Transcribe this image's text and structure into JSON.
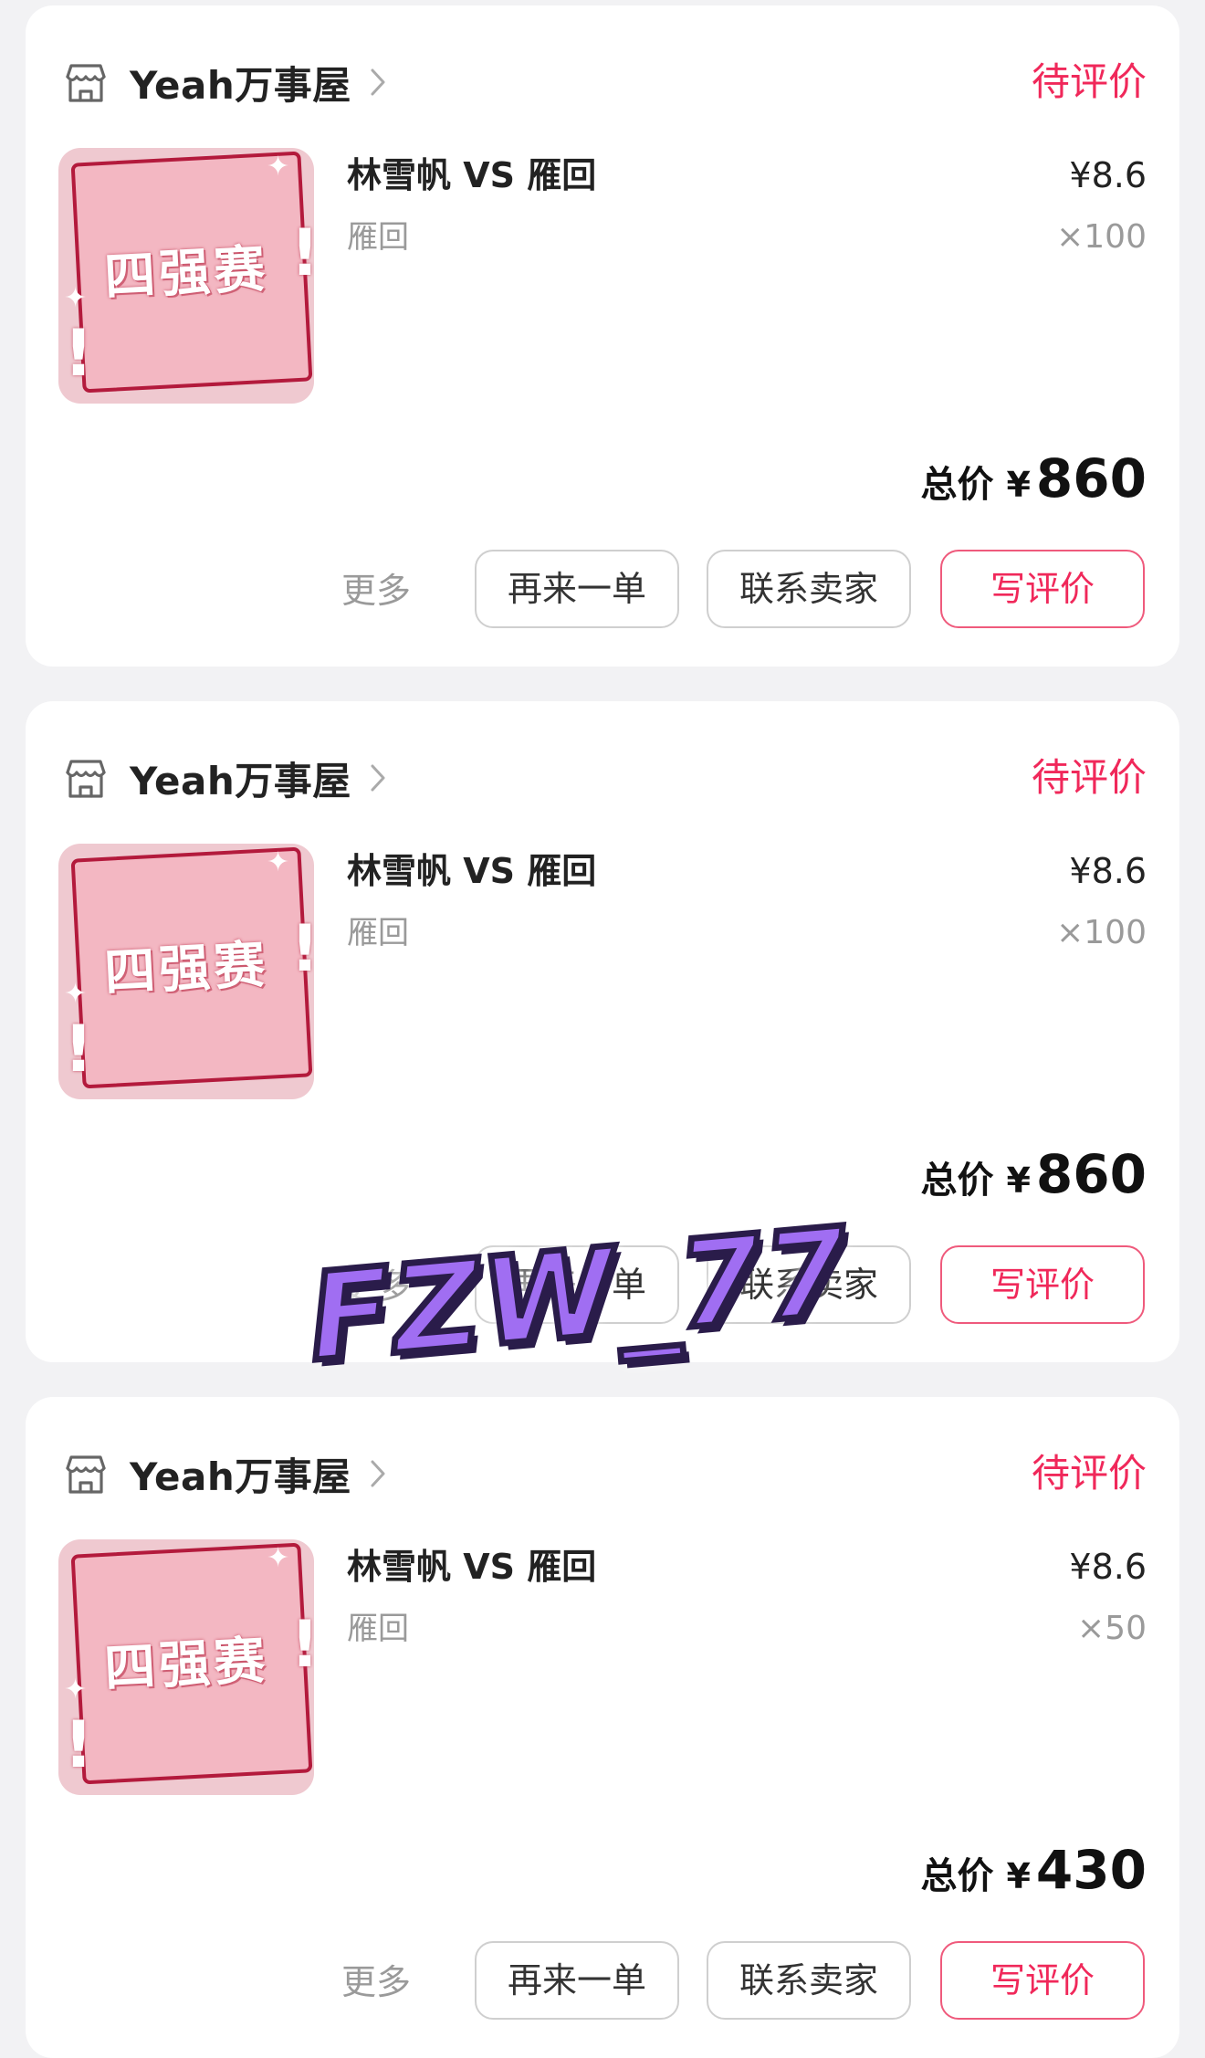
{
  "orders": [
    {
      "shop_name": "Yeah万事屋",
      "status": "待评价",
      "thumb_text": "四强赛",
      "item_title": "林雪帆 VS 雁回",
      "item_subtitle": "雁回",
      "unit_price": "¥8.6",
      "quantity": "×100",
      "total_label": "总价",
      "currency": "¥",
      "total": "860",
      "more": "更多",
      "reorder": "再来一单",
      "contact": "联系卖家",
      "review": "写评价"
    },
    {
      "shop_name": "Yeah万事屋",
      "status": "待评价",
      "thumb_text": "四强赛",
      "item_title": "林雪帆 VS 雁回",
      "item_subtitle": "雁回",
      "unit_price": "¥8.6",
      "quantity": "×100",
      "total_label": "总价",
      "currency": "¥",
      "total": "860",
      "more": "更多",
      "reorder": "再来一单",
      "contact": "联系卖家",
      "review": "写评价"
    },
    {
      "shop_name": "Yeah万事屋",
      "status": "待评价",
      "thumb_text": "四强赛",
      "item_title": "林雪帆 VS 雁回",
      "item_subtitle": "雁回",
      "unit_price": "¥8.6",
      "quantity": "×50",
      "total_label": "总价",
      "currency": "¥",
      "total": "430",
      "more": "更多",
      "reorder": "再来一单",
      "contact": "联系卖家",
      "review": "写评价"
    }
  ],
  "watermark": "FZW_77",
  "colors": {
    "accent": "#f0285a",
    "muted": "#9a9a9a",
    "page_bg": "#f2f2f4"
  },
  "icons": {
    "shop": "shop-icon",
    "chevron": "chevron-right-icon"
  }
}
